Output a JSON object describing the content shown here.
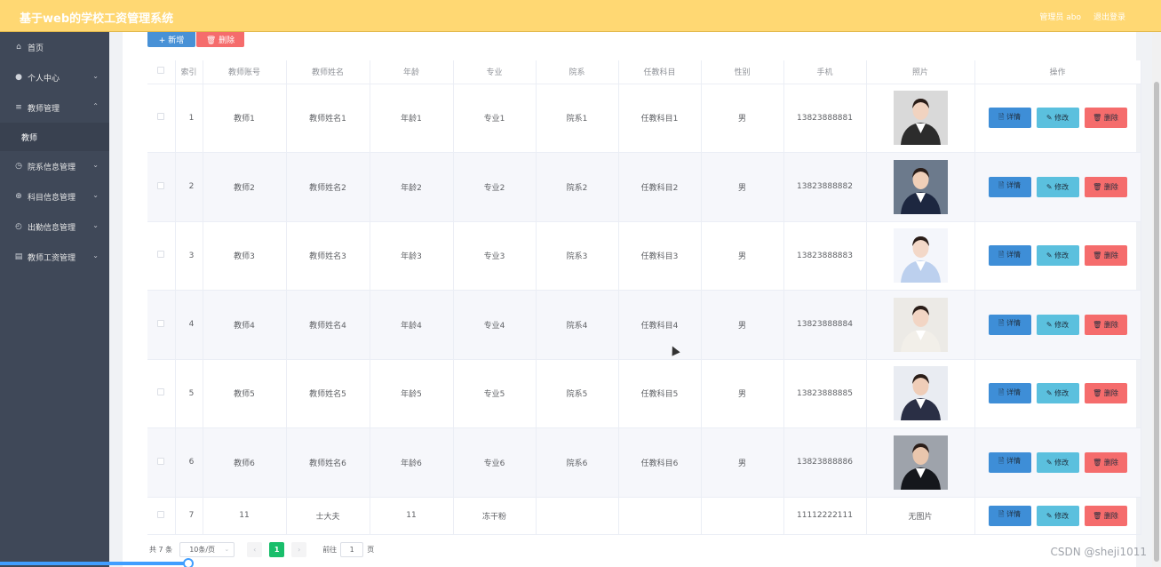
{
  "header": {
    "title": "基于web的学校工资管理系统",
    "user_label": "管理员 abo",
    "logout_label": "退出登录"
  },
  "sidebar": {
    "items": [
      {
        "label": "首页",
        "icon": "home-icon"
      },
      {
        "label": "个人中心",
        "icon": "user-icon"
      },
      {
        "label": "教师管理",
        "icon": "menu-icon"
      },
      {
        "label": "教师",
        "icon": ""
      },
      {
        "label": "院系信息管理",
        "icon": "clock-icon"
      },
      {
        "label": "科目信息管理",
        "icon": "globe-icon"
      },
      {
        "label": "出勤信息管理",
        "icon": "compass-icon"
      },
      {
        "label": "教师工资管理",
        "icon": "clipboard-icon"
      }
    ]
  },
  "toolbar": {
    "add_label": "+ 新增",
    "delete_label": "🗑 删除"
  },
  "table": {
    "headers": [
      "索引",
      "教师账号",
      "教师姓名",
      "年龄",
      "专业",
      "院系",
      "任教科目",
      "性别",
      "手机",
      "照片",
      "操作"
    ],
    "rows": [
      {
        "idx": "1",
        "account": "教师1",
        "name": "教师姓名1",
        "age": "年龄1",
        "major": "专业1",
        "dept": "院系1",
        "subject": "任教科目1",
        "gender": "男",
        "phone": "13823888881",
        "photo": "photo"
      },
      {
        "idx": "2",
        "account": "教师2",
        "name": "教师姓名2",
        "age": "年龄2",
        "major": "专业2",
        "dept": "院系2",
        "subject": "任教科目2",
        "gender": "男",
        "phone": "13823888882",
        "photo": "photo"
      },
      {
        "idx": "3",
        "account": "教师3",
        "name": "教师姓名3",
        "age": "年龄3",
        "major": "专业3",
        "dept": "院系3",
        "subject": "任教科目3",
        "gender": "男",
        "phone": "13823888883",
        "photo": "photo"
      },
      {
        "idx": "4",
        "account": "教师4",
        "name": "教师姓名4",
        "age": "年龄4",
        "major": "专业4",
        "dept": "院系4",
        "subject": "任教科目4",
        "gender": "男",
        "phone": "13823888884",
        "photo": "photo"
      },
      {
        "idx": "5",
        "account": "教师5",
        "name": "教师姓名5",
        "age": "年龄5",
        "major": "专业5",
        "dept": "院系5",
        "subject": "任教科目5",
        "gender": "男",
        "phone": "13823888885",
        "photo": "photo"
      },
      {
        "idx": "6",
        "account": "教师6",
        "name": "教师姓名6",
        "age": "年龄6",
        "major": "专业6",
        "dept": "院系6",
        "subject": "任教科目6",
        "gender": "男",
        "phone": "13823888886",
        "photo": "photo"
      },
      {
        "idx": "7",
        "account": "11",
        "name": "士大夫",
        "age": "11",
        "major": "冻干粉",
        "dept": "",
        "subject": "",
        "gender": "",
        "phone": "11112222111",
        "photo": "无图片"
      }
    ],
    "op_labels": {
      "detail": "🗎 详情",
      "edit": "✎ 修改",
      "remove": "🗑 删除"
    }
  },
  "pagination": {
    "total": "共 7 条",
    "page_size": "10条/页",
    "current_page": "1",
    "goto_label": "前往",
    "goto_value": "1",
    "goto_unit": "页"
  },
  "watermark": "CSDN @sheji1011"
}
